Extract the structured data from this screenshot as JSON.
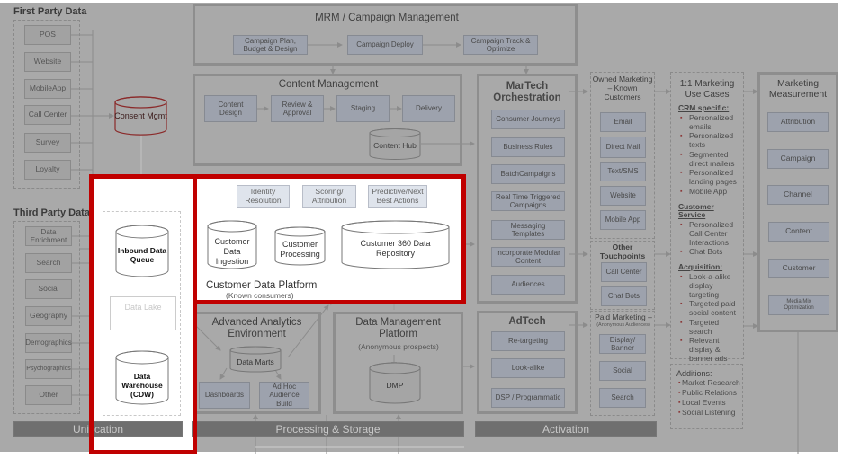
{
  "first_party": {
    "title": "First Party Data",
    "items": [
      "POS",
      "Website",
      "MobileApp",
      "Call Center",
      "Survey",
      "Loyalty"
    ]
  },
  "third_party": {
    "title": "Third Party Data",
    "items": [
      "Data Enrichment",
      "Search",
      "Social",
      "Geography",
      "Demographics",
      "Psychographics",
      "Other"
    ]
  },
  "consent": {
    "label": "Consent Mgmt"
  },
  "unification": {
    "inbound": "Inbound Data Queue",
    "data_lake": "Data Lake",
    "warehouse": "Data Warehouse (CDW)",
    "bar_label": "Unification"
  },
  "mrm": {
    "title": "MRM / Campaign Management",
    "steps": [
      "Campaign Plan, Budget & Design",
      "Campaign Deploy",
      "Campaign Track & Optimize"
    ]
  },
  "content_mgmt": {
    "title": "Content Management",
    "steps": [
      "Content Design",
      "Review & Approval",
      "Staging",
      "Delivery"
    ],
    "hub": "Content Hub"
  },
  "cdp": {
    "top_steps": [
      "Identity Resolution",
      "Scoring/ Attribution",
      "Predictive/Next Best Actions"
    ],
    "ingestion": "Customer Data Ingestion",
    "processing": "Customer Processing",
    "repository": "Customer 360 Data Repository",
    "title": "Customer Data Platform",
    "subtitle": "(Known consumers)"
  },
  "analytics": {
    "title": "Advanced Analytics Environment",
    "marts": "Data Marts",
    "dashboards": "Dashboards",
    "adhoc": "Ad Hoc Audience Build"
  },
  "dmp": {
    "title": "Data Management Platform",
    "subtitle": "(Anonymous prospects)",
    "label": "DMP"
  },
  "processing_bar": "Processing & Storage",
  "martech": {
    "title": "MarTech Orchestration",
    "items": [
      "Consumer Journeys",
      "Business Rules",
      "BatchCampaigns",
      "Real Time Triggered Campaigns",
      "Messaging Templates",
      "Incorporate Modular Content",
      "Audiences"
    ]
  },
  "adtech": {
    "title": "AdTech",
    "items": [
      "Re-targeting",
      "Look-alike",
      "DSP / Programmatic"
    ]
  },
  "activation_bar": "Activation",
  "owned": {
    "title": "Owned Marketing – Known Customers",
    "items": [
      "Email",
      "Direct Mail",
      "Text/SMS",
      "Website",
      "Mobile App"
    ]
  },
  "other_touch": {
    "title": "Other Touchpoints",
    "items": [
      "Call Center",
      "Chat Bots"
    ]
  },
  "paid": {
    "title": "Paid Marketing –",
    "subtitle": "(Anonymous Audiences)",
    "items": [
      "Display/ Banner",
      "Social",
      "Search"
    ]
  },
  "use_cases": {
    "title": "1:1 Marketing Use Cases",
    "groups": [
      {
        "heading": "CRM specific:",
        "items": [
          "Personalized emails",
          "Personalized texts",
          "Segmented direct mailers",
          "Personalized landing pages",
          "Mobile App"
        ]
      },
      {
        "heading": "Customer Service",
        "items": [
          "Personalized Call Center Interactions",
          "Chat Bots"
        ]
      },
      {
        "heading": "Acquisition:",
        "items": [
          "Look-a-alike display targeting",
          "Targeted paid social content",
          "Targeted search",
          "Relevant display & banner ads"
        ]
      }
    ]
  },
  "additions": {
    "title": "Additions:",
    "items": [
      "Market Research",
      "Public Relations",
      "Local Events",
      "Social Listening"
    ]
  },
  "measurement": {
    "title": "Marketing Measurement",
    "items": [
      "Attribution",
      "Campaign",
      "Channel",
      "Content",
      "Customer",
      "Media Mix Optimization"
    ]
  },
  "colors": {
    "highlight": "#c00000",
    "background": "#a9a9a9",
    "box": "#9da2ad"
  }
}
